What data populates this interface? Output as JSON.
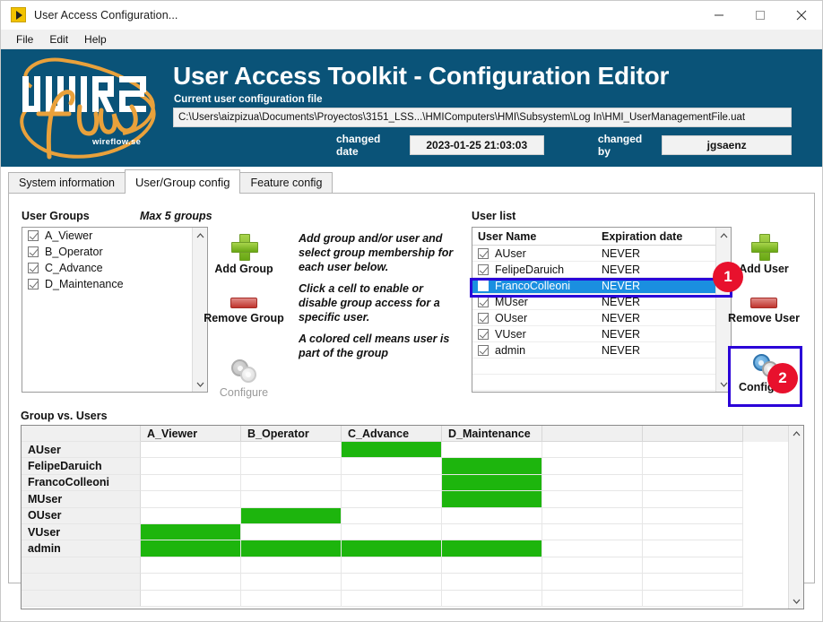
{
  "window": {
    "title": "User Access Configuration...",
    "app_icon": "play-triangle-icon",
    "minimize": "–",
    "maximize": "□",
    "close": "✕"
  },
  "menu": {
    "items": [
      "File",
      "Edit",
      "Help"
    ]
  },
  "banner": {
    "bg_color": "#0a5378",
    "logo_text": "wireflow.se",
    "app_title": "User Access Toolkit - Configuration Editor",
    "config_file_label": "Current user configuration file",
    "config_file_path": "C:\\Users\\aizpizua\\Documents\\Proyectos\\3151_LSS...\\HMIComputers\\HMI\\Subsystem\\Log In\\HMI_UserManagementFile.uat",
    "changed_date_label": "changed date",
    "changed_date_value": "2023-01-25 21:03:03",
    "changed_by_label": "changed by",
    "changed_by_value": "jgsaenz"
  },
  "tabs": [
    {
      "label": "System information",
      "active": false
    },
    {
      "label": "User/Group config",
      "active": true
    },
    {
      "label": "Feature config",
      "active": false
    }
  ],
  "user_groups": {
    "label": "User Groups",
    "max_note": "Max 5 groups",
    "items": [
      {
        "name": "A_Viewer",
        "checked": true
      },
      {
        "name": "B_Operator",
        "checked": true
      },
      {
        "name": "C_Advance",
        "checked": true
      },
      {
        "name": "D_Maintenance",
        "checked": true
      }
    ],
    "scroll_up_icon": "chevron-up-icon",
    "scroll_down_icon": "chevron-down-icon"
  },
  "group_actions": {
    "add_label": "Add Group",
    "add_icon": "plus-icon",
    "remove_label": "Remove Group",
    "remove_icon": "minus-icon",
    "configure_label": "Configure",
    "configure_icon": "gear-icon",
    "configure_disabled": true
  },
  "instructions": [
    "Add group and/or user and select group membership for each user below.",
    "Click a cell to enable or disable group access for a specific user.",
    "A colored cell means user is part of the group"
  ],
  "instructions_lines": {
    "p1": [
      "Add group and/or user and",
      "select group membership for",
      "each user below."
    ],
    "p2": [
      "Click a cell to enable or",
      "disable group access for a",
      "specific user."
    ],
    "p3": [
      "A colored cell means user is",
      "part of the group"
    ]
  },
  "user_list": {
    "label": "User list",
    "columns": [
      "User Name",
      "Expiration date"
    ],
    "sort_icon": "chevron-up-icon",
    "rows": [
      {
        "name": "AUser",
        "expiration": "NEVER",
        "checked": true,
        "selected": false
      },
      {
        "name": "FelipeDaruich",
        "expiration": "NEVER",
        "checked": true,
        "selected": false
      },
      {
        "name": "FrancoColleoni",
        "expiration": "NEVER",
        "checked": true,
        "selected": true
      },
      {
        "name": "MUser",
        "expiration": "NEVER",
        "checked": true,
        "selected": false
      },
      {
        "name": "OUser",
        "expiration": "NEVER",
        "checked": true,
        "selected": false
      },
      {
        "name": "VUser",
        "expiration": "NEVER",
        "checked": true,
        "selected": false
      },
      {
        "name": "admin",
        "expiration": "NEVER",
        "checked": true,
        "selected": false
      }
    ]
  },
  "user_actions": {
    "add_label": "Add User",
    "add_icon": "plus-icon",
    "remove_label": "Remove User",
    "remove_icon": "minus-icon",
    "configure_label": "Configure",
    "configure_icon": "gear-icon"
  },
  "annotations": [
    {
      "number": "1",
      "color": "#e8112d",
      "target": "selected-user-row"
    },
    {
      "number": "2",
      "color": "#e8112d",
      "target": "user-configure-button"
    }
  ],
  "group_vs_users": {
    "label": "Group vs. Users",
    "columns": [
      "",
      "A_Viewer",
      "B_Operator",
      "C_Advance",
      "D_Maintenance",
      "",
      ""
    ],
    "on_color": "#1db50d",
    "rows": [
      {
        "user": "AUser",
        "cells": [
          false,
          false,
          true,
          false,
          false,
          false
        ]
      },
      {
        "user": "FelipeDaruich",
        "cells": [
          false,
          false,
          false,
          true,
          false,
          false
        ]
      },
      {
        "user": "FrancoColleoni",
        "cells": [
          false,
          false,
          false,
          true,
          false,
          false
        ]
      },
      {
        "user": "MUser",
        "cells": [
          false,
          false,
          false,
          true,
          false,
          false
        ]
      },
      {
        "user": "OUser",
        "cells": [
          false,
          true,
          false,
          false,
          false,
          false
        ]
      },
      {
        "user": "VUser",
        "cells": [
          true,
          false,
          false,
          false,
          false,
          false
        ]
      },
      {
        "user": "admin",
        "cells": [
          true,
          true,
          true,
          true,
          false,
          false
        ]
      },
      {
        "user": "",
        "cells": [
          false,
          false,
          false,
          false,
          false,
          false
        ]
      },
      {
        "user": "",
        "cells": [
          false,
          false,
          false,
          false,
          false,
          false
        ]
      },
      {
        "user": "",
        "cells": [
          false,
          false,
          false,
          false,
          false,
          false
        ]
      }
    ],
    "scroll_up_icon": "chevron-up-icon",
    "scroll_down_icon": "chevron-down-icon"
  }
}
